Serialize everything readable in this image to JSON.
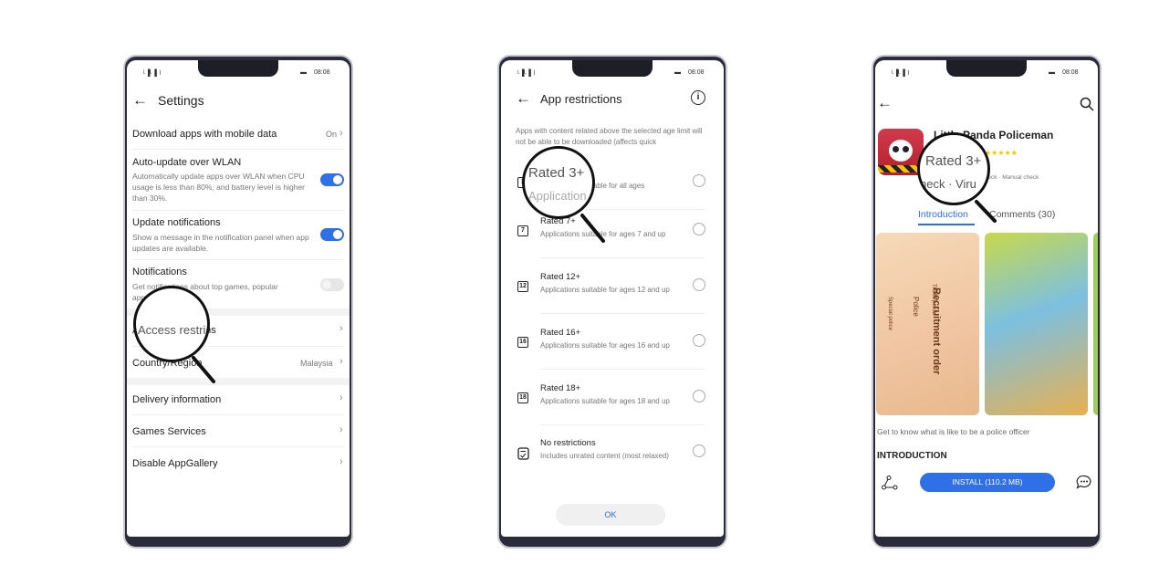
{
  "status": {
    "time": "08:08",
    "signal": "ᴸ▐ᴸ▐ ⌇",
    "battery": "▬"
  },
  "settings": {
    "title": "Settings",
    "download": {
      "label": "Download apps with mobile data",
      "value": "On"
    },
    "auto_update": {
      "label": "Auto-update over WLAN",
      "desc": "Automatically update apps over WLAN when CPU usage is less than 80%, and battery level is higher than 30%.",
      "on": true
    },
    "update_notif": {
      "label": "Update notifications",
      "desc": "Show a message in the notification panel when app updates are available.",
      "on": true
    },
    "notifications": {
      "label": "Notifications",
      "desc": "Get notifications about top games, popular apps and deals.",
      "on": false
    },
    "access": {
      "label": "Access restrictions"
    },
    "country": {
      "label": "Country/Region",
      "value": "Malaysia"
    },
    "delivery": {
      "label": "Delivery information"
    },
    "games": {
      "label": "Games Services"
    },
    "disable": {
      "label": "Disable AppGallery"
    },
    "magnified": "Access restrictions"
  },
  "restrictions": {
    "title": "App restrictions",
    "desc": "Apps with content related above the selected age limit will not be able to be downloaded (affects quick",
    "options": [
      {
        "badge": "3",
        "label": "Rated 3+",
        "desc": "Applications suitable for all ages"
      },
      {
        "badge": "7",
        "label": "Rated 7+",
        "desc": "Applications suitable for ages 7 and up"
      },
      {
        "badge": "12",
        "label": "Rated 12+",
        "desc": "Applications suitable for ages 12 and up"
      },
      {
        "badge": "16",
        "label": "Rated 16+",
        "desc": "Applications suitable for ages 16 and up"
      },
      {
        "badge": "18",
        "label": "Rated 18+",
        "desc": "Applications suitable for ages 18 and up"
      },
      {
        "badge": "",
        "label": "No restrictions",
        "desc": "Includes unrated content (most relaxed)"
      }
    ],
    "ok": "OK",
    "magnified_1": "Rated 3+",
    "magnified_2": "Application"
  },
  "app": {
    "name": "Little Panda Policeman",
    "stars": "★★★★★",
    "checks": "Virus check · Manual check",
    "tabs": [
      "Introduction",
      "Comments (30)"
    ],
    "screenshot_text": [
      "Recruitment order",
      "Police",
      "Traffic police",
      "Special police"
    ],
    "tagline": "Get to know what is like to be a police officer",
    "section": "INTRODUCTION",
    "install": "INSTALL (110.2 MB)",
    "magnified_1": "Rated 3+",
    "magnified_2": "heck · Viru"
  },
  "colors": {
    "accent": "#2f6fe8"
  }
}
